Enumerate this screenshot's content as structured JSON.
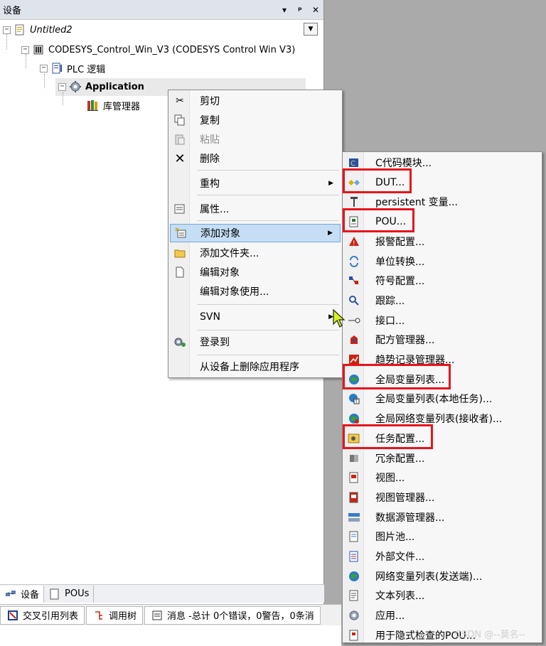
{
  "panel": {
    "title": "设备",
    "pin_label": "▾",
    "dock_label": "ᵖ",
    "close_label": "✕",
    "dropdown_label": "▼"
  },
  "tree": {
    "items": [
      {
        "label": "Untitled2",
        "icon": "project-icon"
      },
      {
        "label": "CODESYS_Control_Win_V3 (CODESYS Control Win V3)",
        "icon": "device-icon"
      },
      {
        "label": "PLC 逻辑",
        "icon": "plc-logic-icon"
      },
      {
        "label": "Application",
        "icon": "application-gear-icon"
      },
      {
        "label": "库管理器",
        "icon": "library-manager-icon"
      }
    ],
    "expander_minus": "−"
  },
  "tabs": {
    "bottom1": [
      {
        "label": "设备",
        "icon": "devices-icon"
      },
      {
        "label": "POUs",
        "icon": "pous-icon"
      }
    ],
    "bottom2": [
      {
        "label": "交叉引用列表",
        "icon": "crossref-icon"
      },
      {
        "label": "调用树",
        "icon": "calltree-icon"
      },
      {
        "label": "消息 -总计 0个错误，0警告，0条消",
        "icon": "messages-icon"
      }
    ]
  },
  "context_menu": {
    "items": [
      {
        "label": "剪切",
        "icon": "scissors-icon"
      },
      {
        "label": "复制",
        "icon": "copy-icon"
      },
      {
        "label": "粘贴",
        "icon": "paste-icon",
        "disabled": true
      },
      {
        "label": "删除",
        "icon": "delete-x-icon"
      },
      {
        "label": "重构",
        "submenu": true
      },
      {
        "label": "属性...",
        "icon": "properties-icon"
      },
      {
        "label": "添加对象",
        "icon": "add-object-icon",
        "submenu": true,
        "highlighted": true
      },
      {
        "label": "添加文件夹...",
        "icon": "folder-icon"
      },
      {
        "label": "编辑对象",
        "icon": "edit-object-icon"
      },
      {
        "label": "编辑对象使用..."
      },
      {
        "label": "SVN",
        "submenu": true
      },
      {
        "label": "登录到",
        "icon": "login-icon"
      },
      {
        "label": "从设备上删除应用程序"
      }
    ],
    "submenu_arrow": "▶"
  },
  "add_object_menu": {
    "items": [
      {
        "label": "C代码模块...",
        "icon": "c-code-icon"
      },
      {
        "label": "DUT...",
        "icon": "dut-icon",
        "boxed": true
      },
      {
        "label": "persistent 变量...",
        "icon": "persistent-var-icon"
      },
      {
        "label": "POU...",
        "icon": "pou-icon",
        "boxed": true
      },
      {
        "label": "报警配置...",
        "icon": "alarm-icon"
      },
      {
        "label": "单位转换...",
        "icon": "unit-conversion-icon"
      },
      {
        "label": "符号配置...",
        "icon": "symbol-config-icon"
      },
      {
        "label": "跟踪...",
        "icon": "trace-icon"
      },
      {
        "label": "接口...",
        "icon": "interface-icon"
      },
      {
        "label": "配方管理器...",
        "icon": "recipe-icon"
      },
      {
        "label": "趋势记录管理器...",
        "icon": "trend-icon"
      },
      {
        "label": "全局变量列表...",
        "icon": "globe-icon",
        "boxed": true
      },
      {
        "label": "全局变量列表(本地任务)...",
        "icon": "globe-task-icon"
      },
      {
        "label": "全局网络变量列表(接收者)...",
        "icon": "globe-network-icon"
      },
      {
        "label": "任务配置...",
        "icon": "task-config-icon",
        "boxed": true
      },
      {
        "label": "冗余配置...",
        "icon": "redundancy-icon"
      },
      {
        "label": "视图...",
        "icon": "visu-icon"
      },
      {
        "label": "视图管理器...",
        "icon": "visu-manager-icon"
      },
      {
        "label": "数据源管理器...",
        "icon": "datasource-icon"
      },
      {
        "label": "图片池...",
        "icon": "image-pool-icon"
      },
      {
        "label": "外部文件...",
        "icon": "external-file-icon"
      },
      {
        "label": "网络变量列表(发送端)...",
        "icon": "network-var-icon"
      },
      {
        "label": "文本列表...",
        "icon": "textlist-icon"
      },
      {
        "label": "应用...",
        "icon": "application-icon"
      },
      {
        "label": "用于隐式检查的POU...",
        "icon": "implicit-pou-icon"
      }
    ]
  },
  "watermark": "CSDN @--莫名--",
  "colors": {
    "highlight": "#c5def5",
    "highlight_border": "#76a6d8",
    "red_box": "#e8141b",
    "header_bg": "#dfe3ea"
  }
}
